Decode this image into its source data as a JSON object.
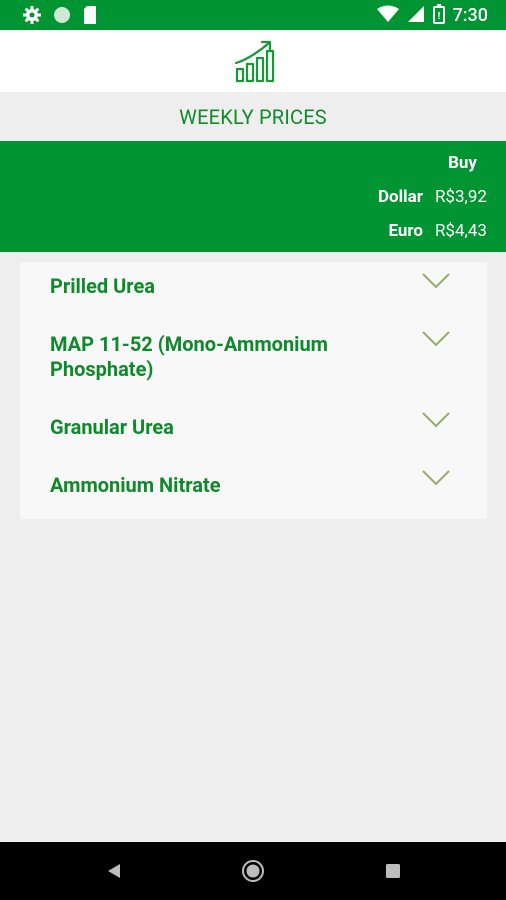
{
  "status_bar": {
    "time": "7:30",
    "left_icons": [
      "gear-icon",
      "circle-icon",
      "sim-card-icon"
    ],
    "right_icons": [
      "wifi-icon",
      "cell-signal-icon",
      "battery-icon"
    ]
  },
  "header": {
    "logo_icon": "rising-chart-icon"
  },
  "section_title": "WEEKLY PRICES",
  "exchange": {
    "buy_label": "Buy",
    "rates": [
      {
        "currency": "Dollar",
        "value": "R$3,92"
      },
      {
        "currency": "Euro",
        "value": "R$4,43"
      }
    ]
  },
  "products": [
    {
      "name": "Prilled Urea"
    },
    {
      "name": "MAP 11-52 (Mono-Ammonium Phosphate)"
    },
    {
      "name": "Granular Urea"
    },
    {
      "name": "Ammonium Nitrate"
    }
  ],
  "colors": {
    "primary_green": "#009432",
    "text_green": "#0e8a2a",
    "chevron": "#9aaa6a",
    "background": "#eeeeee"
  },
  "nav_bar": {
    "buttons": [
      "back-icon",
      "home-icon",
      "recents-icon"
    ]
  }
}
